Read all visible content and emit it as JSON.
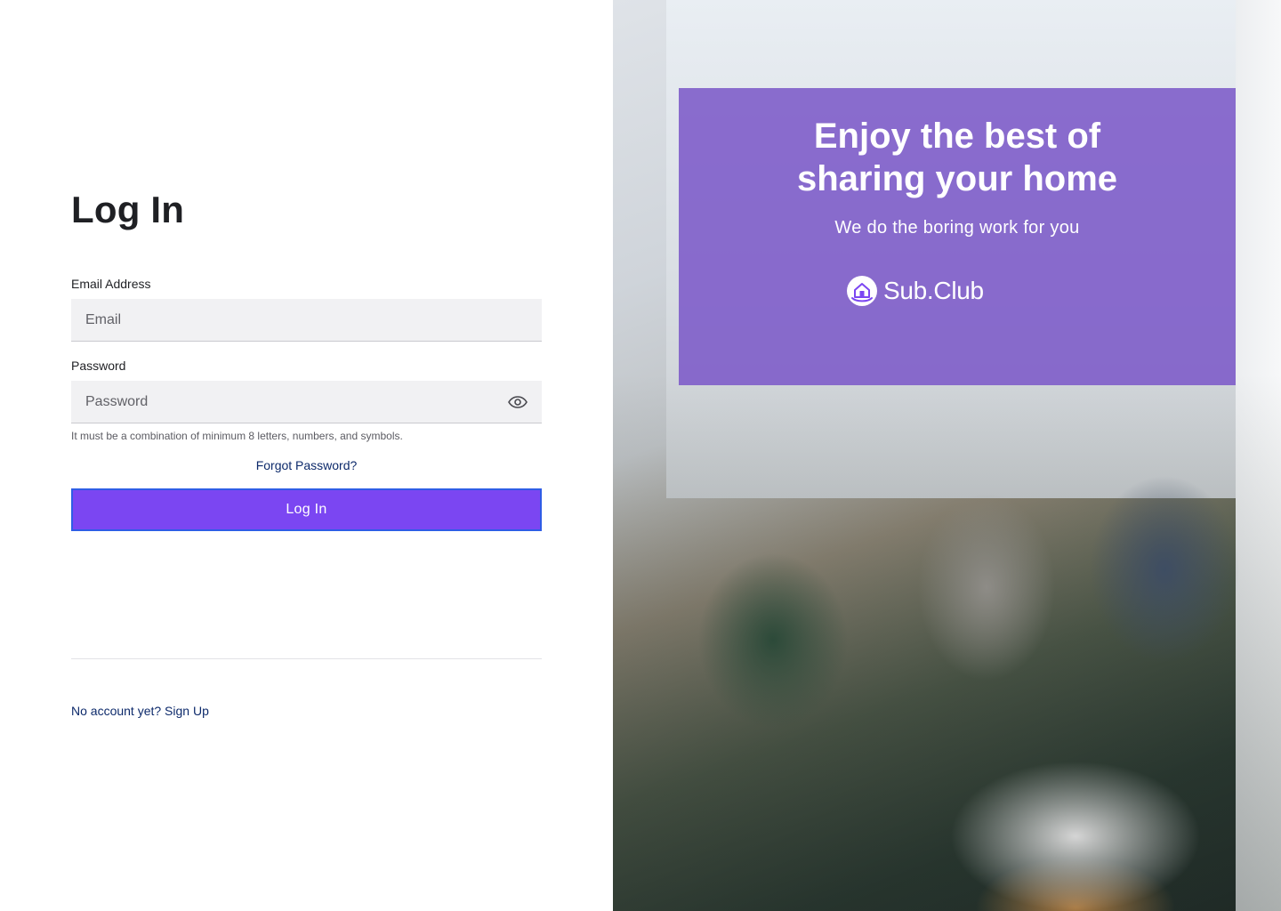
{
  "login": {
    "title": "Log In",
    "email_label": "Email Address",
    "email_placeholder": "Email",
    "email_value": "",
    "password_label": "Password",
    "password_placeholder": "Password",
    "password_value": "",
    "password_hint": "It must be a combination of minimum 8 letters, numbers, and symbols.",
    "forgot_password": "Forgot Password?",
    "submit_label": "Log In",
    "signup_text": "No account yet? Sign Up"
  },
  "hero": {
    "title_line1": "Enjoy the best of",
    "title_line2": "sharing your home",
    "subtitle": "We do the boring work for you",
    "brand_name": "Sub.Club"
  },
  "icons": {
    "password_toggle": "eye-icon",
    "brand_logo": "house-in-hand-logo"
  },
  "colors": {
    "accent": "#7b46f2",
    "button_border": "#2f5de6",
    "link": "#0d2a6b",
    "overlay": "#7c5ac8"
  }
}
